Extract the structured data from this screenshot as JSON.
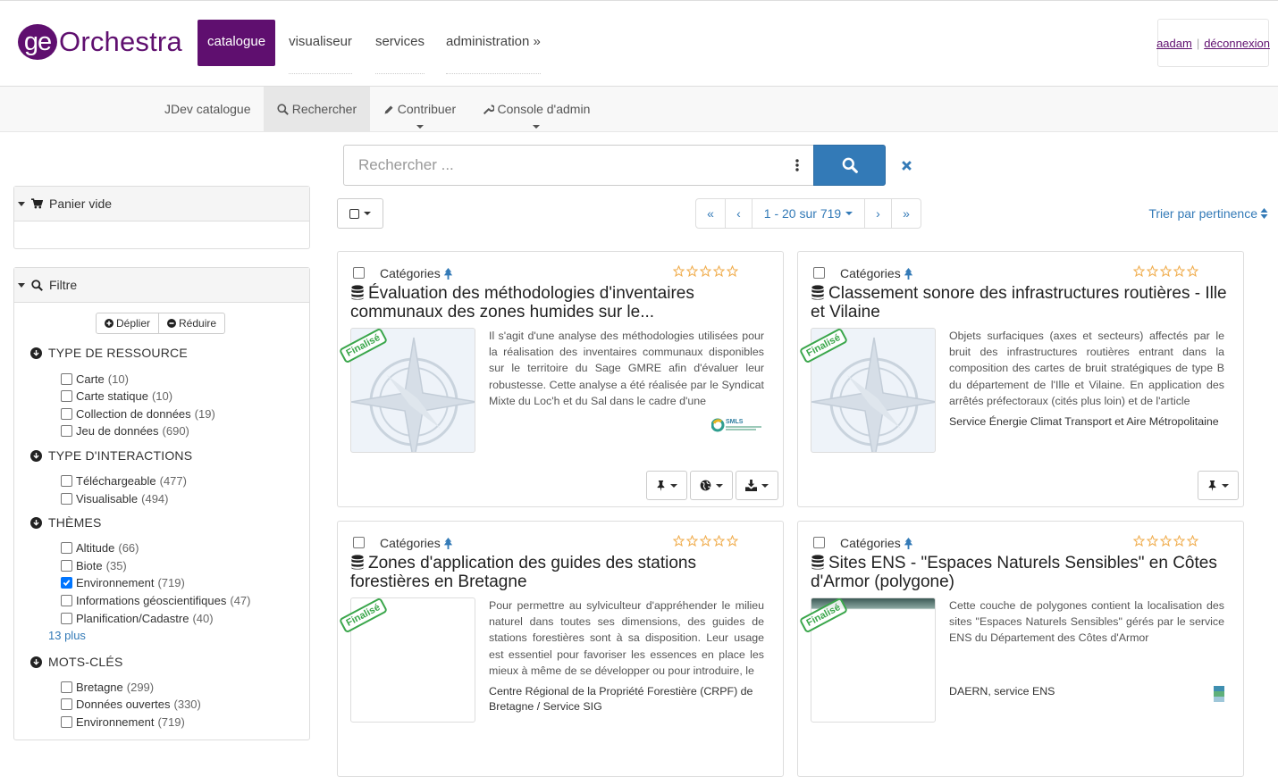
{
  "header": {
    "logo_ge": "ge",
    "logo_rest": "Orchestra",
    "nav": [
      {
        "label": "catalogue",
        "active": true
      },
      {
        "label": "visualiseur"
      },
      {
        "label": "services"
      },
      {
        "label": "administration »"
      }
    ],
    "user": "aadam",
    "logout": "déconnexion"
  },
  "subnav": {
    "brand": "JDev catalogue",
    "search": "Rechercher",
    "contribute": "Contribuer",
    "admin": "Console d'admin"
  },
  "search": {
    "placeholder": "Rechercher ..."
  },
  "cart": {
    "title": "Panier vide"
  },
  "filter": {
    "title": "Filtre",
    "expand": "Déplier",
    "collapse": "Réduire",
    "facets": [
      {
        "title": "TYPE DE RESSOURCE",
        "items": [
          {
            "label": "Carte",
            "count": "(10)"
          },
          {
            "label": "Carte statique",
            "count": "(10)"
          },
          {
            "label": "Collection de données",
            "count": "(19)"
          },
          {
            "label": "Jeu de données",
            "count": "(690)"
          }
        ]
      },
      {
        "title": "TYPE D'INTERACTIONS",
        "items": [
          {
            "label": "Téléchargeable",
            "count": "(477)"
          },
          {
            "label": "Visualisable",
            "count": "(494)"
          }
        ]
      },
      {
        "title": "THÈMES",
        "items": [
          {
            "label": "Altitude",
            "count": "(66)"
          },
          {
            "label": "Biote",
            "count": "(35)"
          },
          {
            "label": "Environnement",
            "count": "(719)",
            "checked": true
          },
          {
            "label": "Informations géoscientifiques",
            "count": "(47)"
          },
          {
            "label": "Planification/Cadastre",
            "count": "(40)"
          }
        ],
        "more": "13  plus"
      },
      {
        "title": "MOTS-CLÉS",
        "items": [
          {
            "label": "Bretagne",
            "count": "(299)"
          },
          {
            "label": "Données ouvertes",
            "count": "(330)"
          },
          {
            "label": "Environnement",
            "count": "(719)"
          }
        ]
      }
    ]
  },
  "pager": {
    "first": "«",
    "prev": "‹",
    "range": "1 - 20 sur 719",
    "next": "›",
    "last": "»"
  },
  "sort": "Trier par pertinence",
  "results": [
    {
      "category": "Catégories",
      "title": "Évaluation des méthodologies d'inventaires communaux des zones humides sur le...",
      "status": "Finalisé",
      "abstract": "Il s'agit d'une analyse des méthodologies utilisées pour la réalisation des inventaires communaux disponibles sur le territoire du Sage GMRE afin d'évaluer leur robustesse. Cette analyse a été réalisée par le Syndicat Mixte du Loc'h et du Sal dans le cadre d'une",
      "org": "",
      "logo": "SMLS"
    },
    {
      "category": "Catégories",
      "title": "Classement sonore des infrastructures routières - Ille et Vilaine",
      "status": "Finalisé",
      "abstract": "Objets surfaciques (axes et secteurs) affectés par le bruit des infrastructures routières entrant dans la composition des cartes de bruit stratégiques de type B du département de l'Ille et Vilaine. En application des arrêtés préfectoraux (cités plus loin) et de l'article",
      "org": "Service Énergie Climat Transport et Aire Métropolitaine"
    },
    {
      "category": "Catégories",
      "title": "Zones d'application des guides des stations forestières en Bretagne",
      "status": "Finalisé",
      "abstract": "Pour permettre au sylviculteur d'appréhender le milieu naturel dans toutes ses dimensions, des guides de stations forestières sont à sa disposition. Leur usage est essentiel pour favoriser les essences en place les mieux à même de se développer ou pour introduire, le",
      "org": "Centre Régional de la Propriété Forestière (CRPF) de Bretagne / Service SIG"
    },
    {
      "category": "Catégories",
      "title": "Sites ENS - \"Espaces Naturels Sensibles\" en Côtes d'Armor (polygone)",
      "status": "Finalisé",
      "abstract": "Cette couche de polygones contient la localisation des sites \"Espaces Naturels Sensibles\" gérés par le service ENS du Département des Côtes d'Armor",
      "org": "DAERN, service ENS"
    }
  ],
  "colors": {
    "brand": "#5f0f6f",
    "primary": "#337ab7",
    "status": "#3aa64b",
    "star": "#f0ad4e"
  }
}
